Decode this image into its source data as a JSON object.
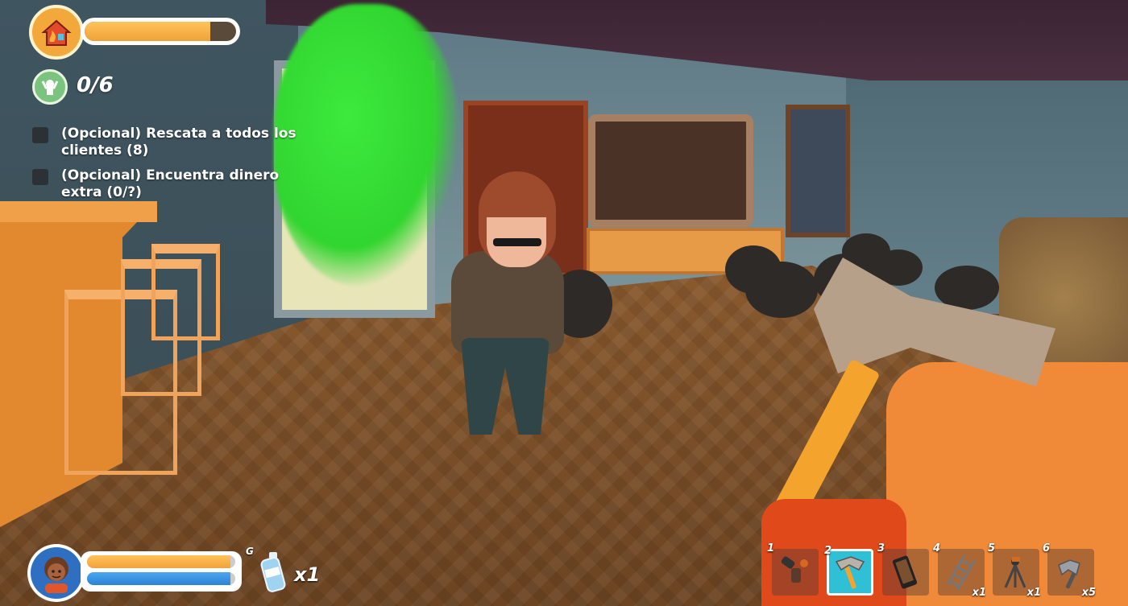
{
  "hud": {
    "home_icon": "house-on-fire-icon",
    "home_bar_percent": 83,
    "rescue_icon": "rescued-person-icon",
    "rescued_count": "0/6"
  },
  "objectives": [
    {
      "text": "(Opcional) Rescata a todos los clientes (8)"
    },
    {
      "text": "(Opcional) Encuentra dinero extra (0/?)"
    }
  ],
  "player": {
    "avatar_icon": "firefighter-avatar-icon",
    "health_percent": 97,
    "stamina_percent": 97,
    "grenade_key": "G",
    "grenade_icon": "extinguisher-bottle-icon",
    "grenade_count": "x1"
  },
  "toolbar": {
    "slots": [
      {
        "num": "1",
        "icon": "hose-nozzle-icon",
        "count": ""
      },
      {
        "num": "2",
        "icon": "fire-axe-icon",
        "count": "",
        "active": true
      },
      {
        "num": "3",
        "icon": "phone-icon",
        "count": ""
      },
      {
        "num": "4",
        "icon": "ladder-icon",
        "count": "x1"
      },
      {
        "num": "5",
        "icon": "tripod-sprinkler-icon",
        "count": "x1"
      },
      {
        "num": "6",
        "icon": "throwing-axe-icon",
        "count": "x5"
      }
    ]
  }
}
